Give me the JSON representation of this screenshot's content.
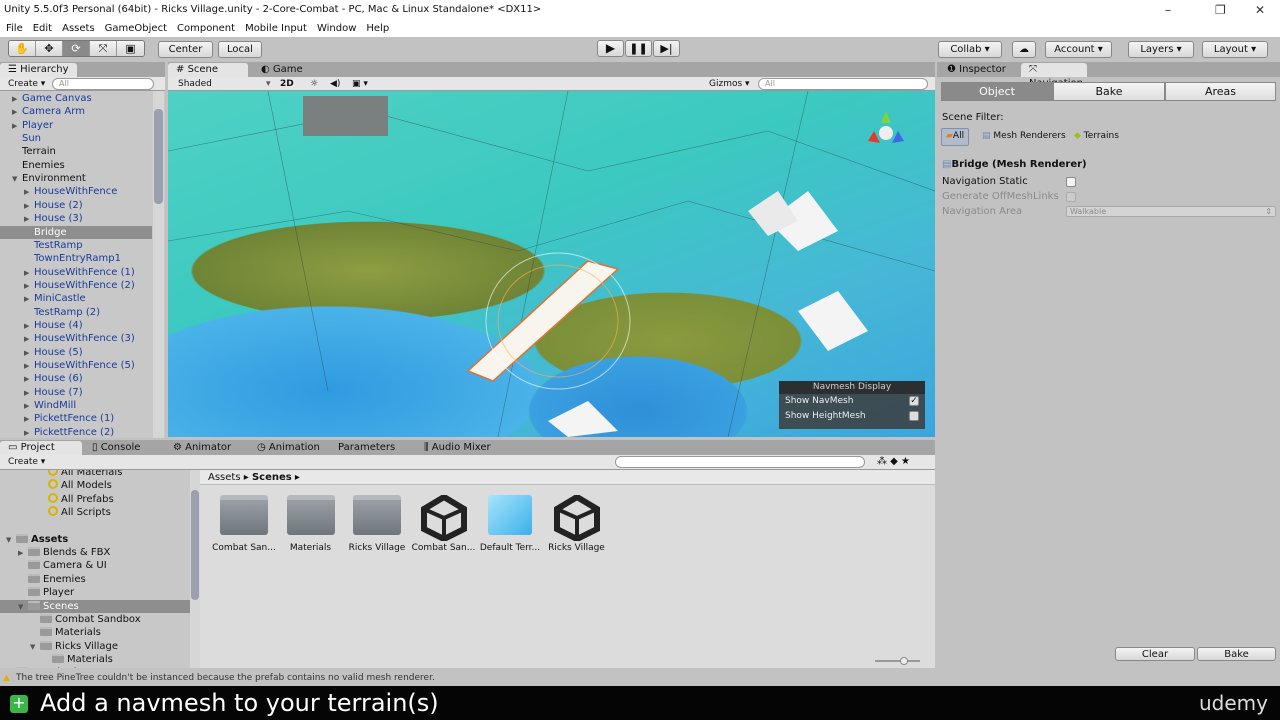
{
  "window": {
    "title": "Unity 5.5.0f3 Personal (64bit) - Ricks Village.unity - 2-Core-Combat - PC, Mac & Linux Standalone* <DX11>"
  },
  "menu": [
    "File",
    "Edit",
    "Assets",
    "GameObject",
    "Component",
    "Mobile Input",
    "Window",
    "Help"
  ],
  "toolbar": {
    "tools": [
      "hand-tool",
      "move-tool",
      "rotate-tool",
      "scale-tool",
      "rect-tool"
    ],
    "center": "Center",
    "local": "Local",
    "collab": "Collab",
    "account": "Account",
    "layers": "Layers",
    "layout": "Layout"
  },
  "hierarchy": {
    "title": "Hierarchy",
    "create": "Create",
    "search_placeholder": "All",
    "items": [
      {
        "label": "Game Canvas",
        "indent": 0,
        "arrow": "right",
        "color": "blue"
      },
      {
        "label": "Camera Arm",
        "indent": 0,
        "arrow": "right",
        "color": "blue"
      },
      {
        "label": "Player",
        "indent": 0,
        "arrow": "right",
        "color": "blue"
      },
      {
        "label": "Sun",
        "indent": 0,
        "arrow": "",
        "color": "blue"
      },
      {
        "label": "Terrain",
        "indent": 0,
        "arrow": "",
        "color": "black"
      },
      {
        "label": "Enemies",
        "indent": 0,
        "arrow": "",
        "color": "black"
      },
      {
        "label": "Environment",
        "indent": 0,
        "arrow": "down",
        "color": "black"
      },
      {
        "label": "HouseWithFence",
        "indent": 1,
        "arrow": "right",
        "color": "blue"
      },
      {
        "label": "House (2)",
        "indent": 1,
        "arrow": "right",
        "color": "blue"
      },
      {
        "label": "House (3)",
        "indent": 1,
        "arrow": "right",
        "color": "blue"
      },
      {
        "label": "Bridge",
        "indent": 1,
        "arrow": "",
        "color": "selected"
      },
      {
        "label": "TestRamp",
        "indent": 1,
        "arrow": "",
        "color": "blue"
      },
      {
        "label": "TownEntryRamp1",
        "indent": 1,
        "arrow": "",
        "color": "blue"
      },
      {
        "label": "HouseWithFence (1)",
        "indent": 1,
        "arrow": "right",
        "color": "blue"
      },
      {
        "label": "HouseWithFence (2)",
        "indent": 1,
        "arrow": "right",
        "color": "blue"
      },
      {
        "label": "MiniCastle",
        "indent": 1,
        "arrow": "right",
        "color": "blue"
      },
      {
        "label": "TestRamp (2)",
        "indent": 1,
        "arrow": "",
        "color": "blue"
      },
      {
        "label": "House (4)",
        "indent": 1,
        "arrow": "right",
        "color": "blue"
      },
      {
        "label": "HouseWithFence (3)",
        "indent": 1,
        "arrow": "right",
        "color": "blue"
      },
      {
        "label": "House (5)",
        "indent": 1,
        "arrow": "right",
        "color": "blue"
      },
      {
        "label": "HouseWithFence (5)",
        "indent": 1,
        "arrow": "right",
        "color": "blue"
      },
      {
        "label": "House (6)",
        "indent": 1,
        "arrow": "right",
        "color": "blue"
      },
      {
        "label": "House (7)",
        "indent": 1,
        "arrow": "right",
        "color": "blue"
      },
      {
        "label": "WindMill",
        "indent": 1,
        "arrow": "right",
        "color": "blue"
      },
      {
        "label": "PickettFence (1)",
        "indent": 1,
        "arrow": "right",
        "color": "blue"
      },
      {
        "label": "PickettFence (2)",
        "indent": 1,
        "arrow": "right",
        "color": "blue"
      }
    ]
  },
  "scene": {
    "tabs": [
      "Scene",
      "Game"
    ],
    "shading": "Shaded",
    "mode_2d": "2D",
    "gizmos": "Gizmos",
    "search_placeholder": "All",
    "navmesh_display": {
      "title": "Navmesh Display",
      "show_navmesh": "Show NavMesh",
      "show_navmesh_checked": true,
      "show_heightmesh": "Show HeightMesh",
      "show_heightmesh_checked": false
    }
  },
  "inspector": {
    "tabs": [
      "Inspector",
      "Navigation"
    ],
    "active_tab": "Navigation",
    "segments": [
      "Object",
      "Bake",
      "Areas"
    ],
    "active_segment": "Object",
    "scene_filter_label": "Scene Filter:",
    "filters": [
      "All",
      "Mesh Renderers",
      "Terrains"
    ],
    "object_title": "Bridge (Mesh Renderer)",
    "navigation_static": "Navigation Static",
    "generate_offmeshlinks": "Generate OffMeshLinks",
    "navigation_area": "Navigation Area",
    "navigation_area_value": "Walkable",
    "clear": "Clear",
    "bake": "Bake"
  },
  "bottom_tabs": [
    "Project",
    "Console",
    "Animator",
    "Animation",
    "Parameters",
    "Audio Mixer"
  ],
  "project": {
    "create": "Create",
    "tree": [
      {
        "label": "All Materials",
        "kind": "search",
        "indent": 1
      },
      {
        "label": "All Models",
        "kind": "search",
        "indent": 1
      },
      {
        "label": "All Prefabs",
        "kind": "search",
        "indent": 1
      },
      {
        "label": "All Scripts",
        "kind": "search",
        "indent": 1
      },
      {
        "label": "",
        "kind": "spacer",
        "indent": 0
      },
      {
        "label": "Assets",
        "kind": "folder",
        "indent": 0,
        "arrow": "down",
        "bold": true
      },
      {
        "label": "Blends & FBX",
        "kind": "folder",
        "indent": 1,
        "arrow": "right"
      },
      {
        "label": "Camera & UI",
        "kind": "folder",
        "indent": 1
      },
      {
        "label": "Enemies",
        "kind": "folder",
        "indent": 1
      },
      {
        "label": "Player",
        "kind": "folder",
        "indent": 1
      },
      {
        "label": "Scenes",
        "kind": "folder",
        "indent": 1,
        "arrow": "down",
        "selected": true
      },
      {
        "label": "Combat Sandbox",
        "kind": "folder",
        "indent": 2
      },
      {
        "label": "Materials",
        "kind": "folder",
        "indent": 2
      },
      {
        "label": "Ricks Village",
        "kind": "folder",
        "indent": 2,
        "arrow": "down"
      },
      {
        "label": "Materials",
        "kind": "folder",
        "indent": 3
      },
      {
        "label": "Standard Assets",
        "kind": "folder",
        "indent": 0,
        "arrow": "right"
      }
    ],
    "breadcrumb": [
      "Assets",
      "Scenes"
    ],
    "assets": [
      {
        "label": "Combat San...",
        "type": "folder"
      },
      {
        "label": "Materials",
        "type": "folder"
      },
      {
        "label": "Ricks Village",
        "type": "folder"
      },
      {
        "label": "Combat San...",
        "type": "unity-scene"
      },
      {
        "label": "Default Terr...",
        "type": "terrain-data"
      },
      {
        "label": "Ricks Village",
        "type": "unity-scene"
      }
    ]
  },
  "status": {
    "message": "The tree PineTree couldn't be instanced because the prefab contains no valid mesh renderer."
  },
  "caption": {
    "text": "Add a navmesh to your terrain(s)",
    "brand": "udemy"
  },
  "colors": {
    "selection": "#8e8e8e",
    "scene_water": "#3aa6de",
    "scene_navmesh": "#4fd1c5",
    "hierarchy_blue": "#1a3b9a"
  }
}
